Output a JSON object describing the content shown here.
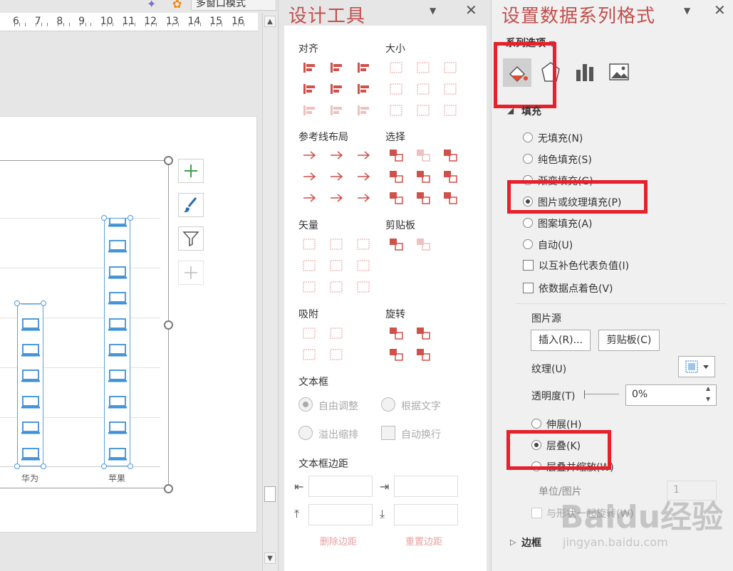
{
  "top_toolbar": {
    "multi_window_label": "多窗口模式"
  },
  "ruler": {
    "marks": [
      "6",
      "7",
      "8",
      "9",
      "10",
      "11",
      "12",
      "13",
      "14",
      "15",
      "16"
    ]
  },
  "chart_data": {
    "type": "bar",
    "categories": [
      "华为",
      "苹果"
    ],
    "values": [
      6.3,
      9.6
    ],
    "fill": "picture-stack-laptop-icon",
    "bar_outline_color": "#5aa0e0"
  },
  "design_tools": {
    "title": "设计工具",
    "sections": {
      "align": "对齐",
      "size": "大小",
      "guides": "参考线布局",
      "select": "选择",
      "vector": "矢量",
      "clipboard": "剪贴板",
      "snap": "吸附",
      "rotate": "旋转",
      "textbox": "文本框",
      "margin": "文本框边距"
    },
    "textbox_options": [
      "自由调整",
      "根据文字",
      "溢出缩排",
      "自动换行"
    ],
    "margin_buttons": {
      "delete": "删除边距",
      "reset": "重置边距"
    }
  },
  "format_panel": {
    "title": "设置数据系列格式",
    "series_options_label": "系列选项",
    "fill_section": "填充",
    "fill_options": [
      {
        "label": "无填充(N)",
        "selected": false
      },
      {
        "label": "纯色填充(S)",
        "selected": false
      },
      {
        "label": "渐变填充(G)",
        "selected": false
      },
      {
        "label": "图片或纹理填充(P)",
        "selected": true
      },
      {
        "label": "图案填充(A)",
        "selected": false
      },
      {
        "label": "自动(U)",
        "selected": false
      }
    ],
    "checkboxes": [
      "以互补色代表负值(I)",
      "依数据点着色(V)"
    ],
    "picture_source_label": "图片源",
    "insert_button": "插入(R)...",
    "clipboard_button": "剪贴板(C)",
    "texture_label": "纹理(U)",
    "transparency_label": "透明度(T)",
    "transparency_value": "0%",
    "stretch_label": "伸展(H)",
    "stack_label": "层叠(K)",
    "stack_scale_label": "层叠并缩放(W)",
    "unit_label": "单位/图片",
    "unit_value": "1",
    "rotate_with_shape": "与形状一起旋转(W)",
    "border_section": "边框",
    "accent_color": "#e8202a"
  },
  "watermark": {
    "text": "Baidu经验",
    "subtext": "jingyan.baidu.com"
  }
}
